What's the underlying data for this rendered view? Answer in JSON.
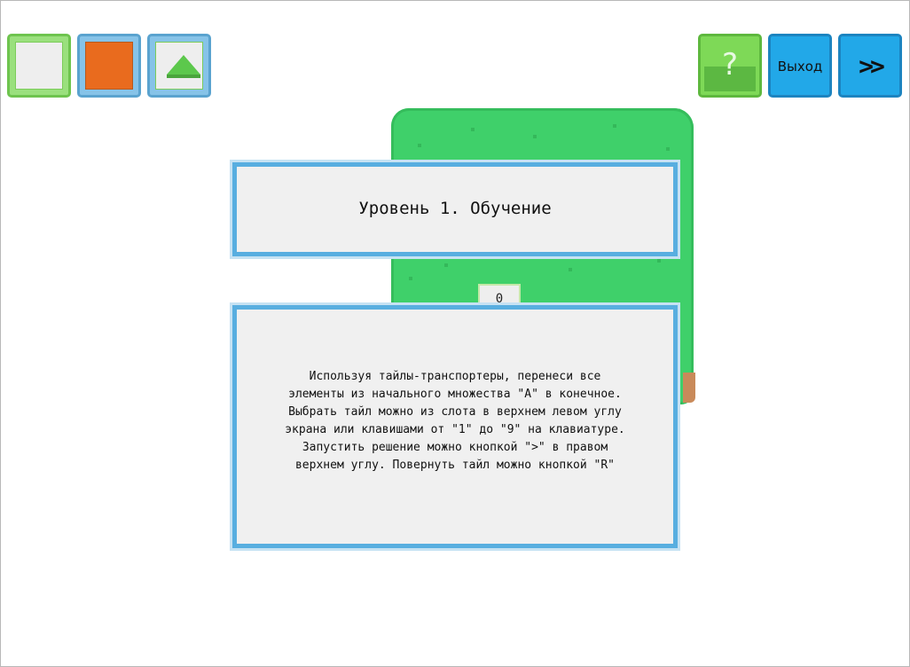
{
  "tile_slots": [
    {
      "name": "empty-tile",
      "fill": "#eeeeee",
      "border": "#6ec44e",
      "selected": true
    },
    {
      "name": "orange-tile",
      "fill": "#e96b1e",
      "border": "#5aa3cf",
      "selected": false
    },
    {
      "name": "transporter-up-tile",
      "fill": "#eeeeee",
      "border": "#5aa3cf",
      "icon": "arrow-up-icon",
      "selected": false
    }
  ],
  "toolbar": {
    "help_label": "?",
    "exit_label": "Выход",
    "next_label": ">>"
  },
  "board": {
    "tile_label": "0",
    "grass_color": "#3fd06a"
  },
  "dialog": {
    "title": "Уровень 1. Обучение",
    "body": "Используя тайлы-транспортеры, перенеси все\nэлементы из начального множества \"A\" в конечное.\nВыбрать тайл можно из слота в верхнем левом углу\nэкрана или клавишами от \"1\" до \"9\" на клавиатуре.\nЗапустить решение можно кнопкой \">\" в правом\nверхнем углу. Повернуть тайл можно кнопкой \"R\""
  },
  "colors": {
    "accent_blue": "#22a8e8",
    "accent_green": "#7ed957",
    "panel_border": "#58aee0",
    "panel_fill": "#f0f0f0"
  }
}
